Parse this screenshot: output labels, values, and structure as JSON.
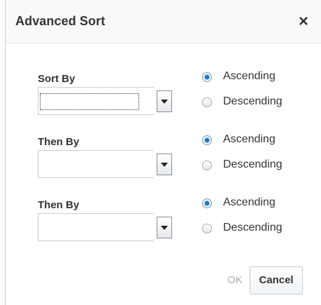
{
  "dialog": {
    "title": "Advanced Sort",
    "close_symbol": "×"
  },
  "sort_groups": [
    {
      "label": "Sort By",
      "value": "",
      "ascending_label": "Ascending",
      "descending_label": "Descending",
      "selected": "ascending"
    },
    {
      "label": "Then By",
      "value": "",
      "ascending_label": "Ascending",
      "descending_label": "Descending",
      "selected": "ascending"
    },
    {
      "label": "Then By",
      "value": "",
      "ascending_label": "Ascending",
      "descending_label": "Descending",
      "selected": "ascending"
    }
  ],
  "buttons": {
    "ok_label": "OK",
    "cancel_label": "Cancel"
  },
  "icons": {
    "close": "close-icon",
    "dropdown": "chevron-down-icon",
    "radio_checked": "radio-checked-icon",
    "radio_unchecked": "radio-unchecked-icon"
  },
  "colors": {
    "header_background": "#f9f9f9",
    "radio_accent": "#2a7fc9",
    "disabled_text": "#a8b0b7"
  }
}
